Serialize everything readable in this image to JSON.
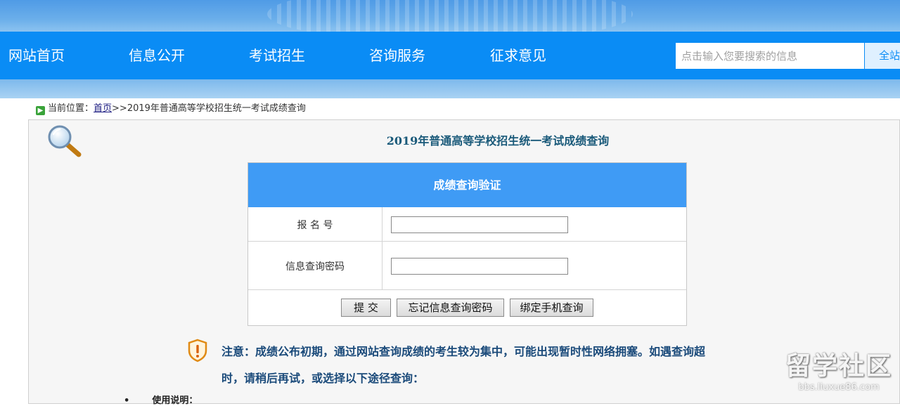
{
  "nav": {
    "items": [
      {
        "label": "网站首页"
      },
      {
        "label": "信息公开"
      },
      {
        "label": "考试招生"
      },
      {
        "label": "咨询服务"
      },
      {
        "label": "征求意见"
      }
    ],
    "search": {
      "placeholder": "点击输入您要搜索的信息",
      "scope_label": "全站"
    }
  },
  "breadcrumb": {
    "prefix": "当前位置：",
    "home": "首页",
    "separator": ">>",
    "current": "2019年普通高等学校招生统一考试成绩查询"
  },
  "page": {
    "title": "2019年普通高等学校招生统一考试成绩查询"
  },
  "form": {
    "header": "成绩查询验证",
    "fields": [
      {
        "label": "报 名 号",
        "value": ""
      },
      {
        "label": "信息查询密码",
        "value": ""
      }
    ],
    "buttons": {
      "submit": "提 交",
      "forgot": "忘记信息查询密码",
      "bind_phone": "绑定手机查询"
    }
  },
  "notice": {
    "line1": "注意：成绩公布初期，通过网站查询成绩的考生较为集中，可能出现暂时性网络拥塞。如遇查询超",
    "line2": "时，请稍后再试，或选择以下途径查询："
  },
  "usage": {
    "bullet": "•",
    "label": "使用说明："
  },
  "watermark": {
    "title": "留学社区",
    "url": "bbs.liuxue86.com"
  },
  "colors": {
    "nav_bg": "#0a8cf5",
    "form_header_bg": "#3f9bf5",
    "title_text": "#1a5a7a"
  }
}
